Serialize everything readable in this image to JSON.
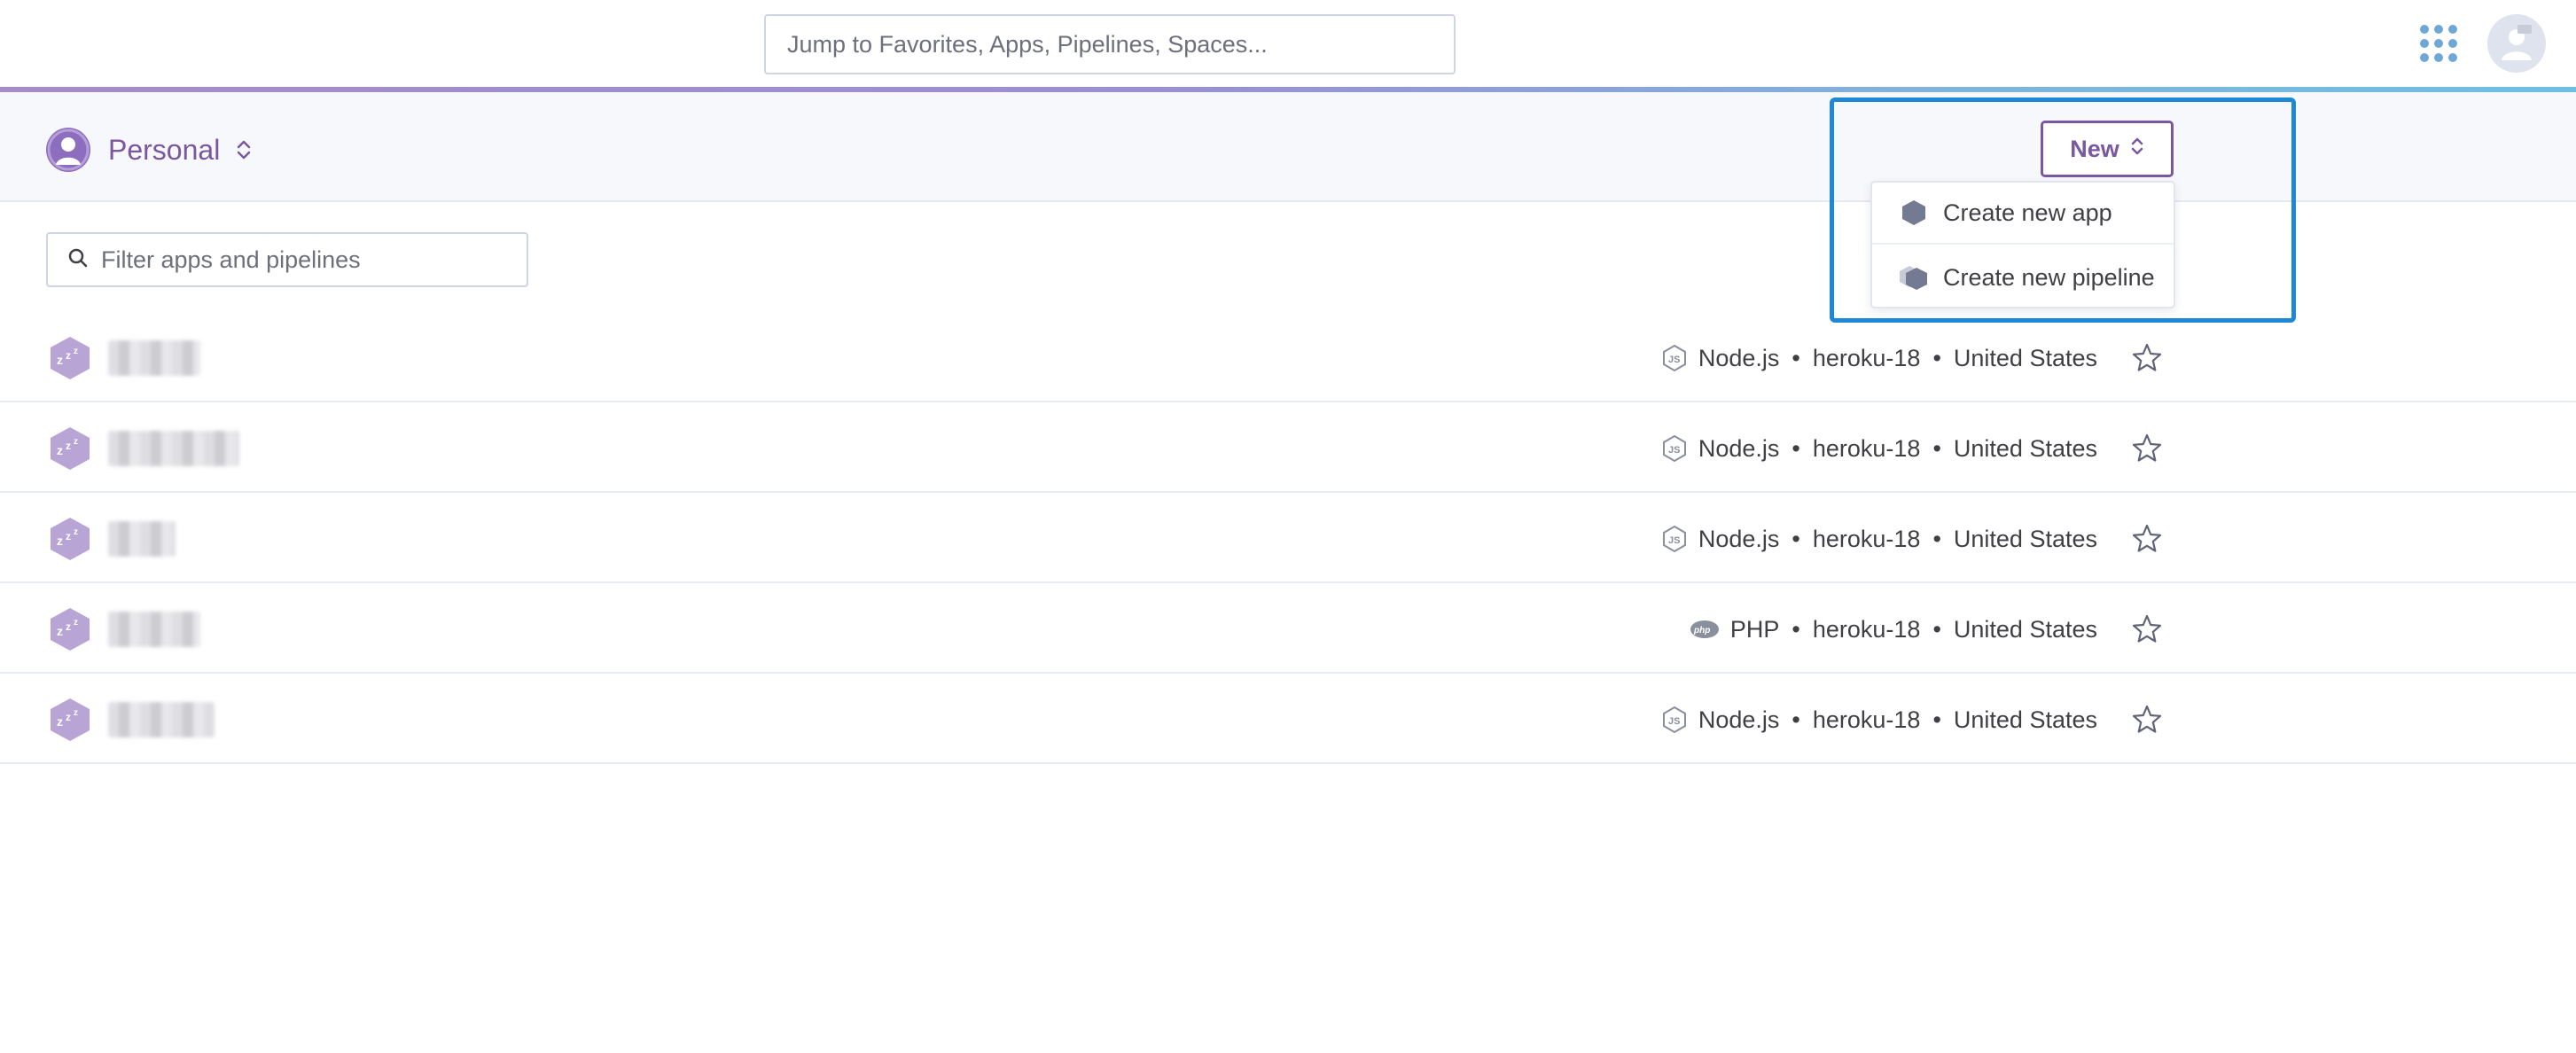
{
  "topbar": {
    "search_placeholder": "Jump to Favorites, Apps, Pipelines, Spaces...",
    "apps_icon": "apps-grid-icon",
    "avatar_icon": "user-avatar-icon"
  },
  "account": {
    "label": "Personal",
    "icon": "user-icon"
  },
  "new_menu": {
    "button_label": "New",
    "items": [
      {
        "label": "Create new app",
        "icon": "app-hexagon-icon"
      },
      {
        "label": "Create new pipeline",
        "icon": "pipeline-icon"
      }
    ]
  },
  "filter": {
    "placeholder": "Filter apps and pipelines"
  },
  "apps": [
    {
      "language": "Node.js",
      "lang_icon": "nodejs-icon",
      "stack": "heroku-18",
      "region": "United States"
    },
    {
      "language": "Node.js",
      "lang_icon": "nodejs-icon",
      "stack": "heroku-18",
      "region": "United States"
    },
    {
      "language": "Node.js",
      "lang_icon": "nodejs-icon",
      "stack": "heroku-18",
      "region": "United States"
    },
    {
      "language": "PHP",
      "lang_icon": "php-icon",
      "stack": "heroku-18",
      "region": "United States"
    },
    {
      "language": "Node.js",
      "lang_icon": "nodejs-icon",
      "stack": "heroku-18",
      "region": "United States"
    }
  ],
  "colors": {
    "brand_purple": "#79589f",
    "highlight_blue": "#1e88d6",
    "app_hex": "#b9a4d6"
  },
  "separator": "•"
}
